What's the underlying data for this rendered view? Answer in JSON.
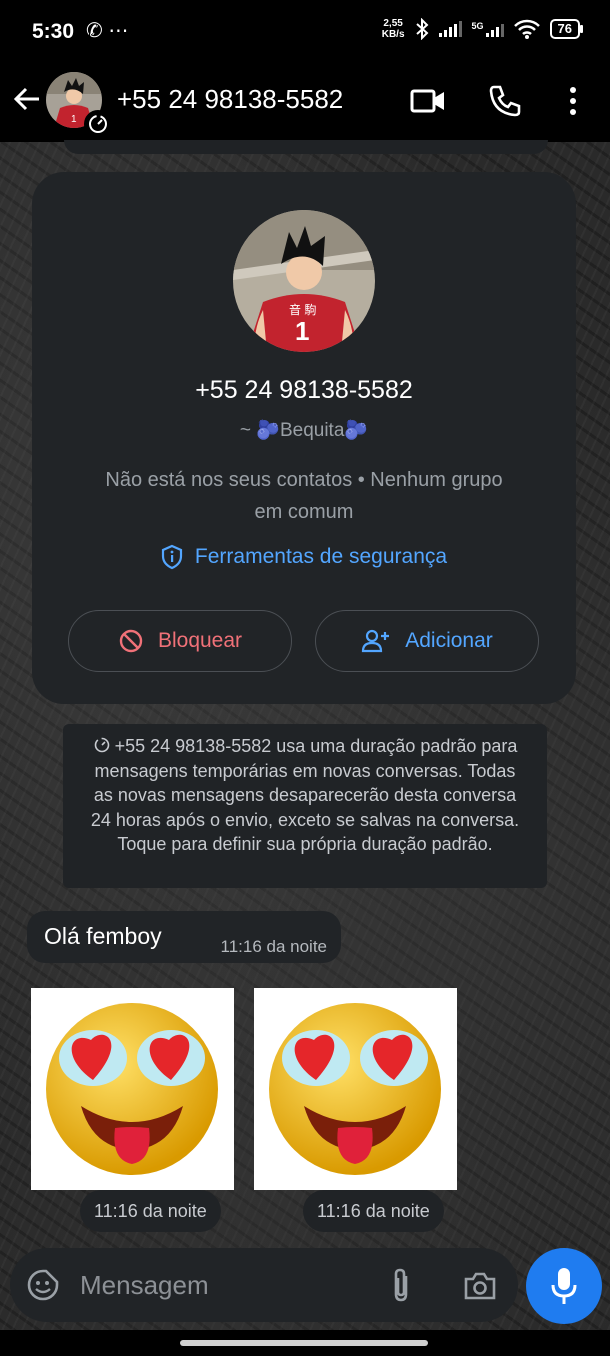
{
  "status_bar": {
    "time": "5:30",
    "left_icons": "✆ ⋯",
    "net_speed_value": "2,55",
    "net_speed_unit": "KB/s",
    "network": "5G",
    "battery": "76"
  },
  "header": {
    "title": "+55 24 98138-5582"
  },
  "profile_card": {
    "phone": "+55 24 98138-5582",
    "name": "~ 🫐Bequita🫐",
    "info_line1": "Não está nos seus contatos • Nenhum grupo",
    "info_line2": "em comum",
    "security_label": "Ferramentas de segurança",
    "block_label": "Bloquear",
    "add_label": "Adicionar"
  },
  "notice": {
    "text": "+55 24 98138-5582 usa uma duração padrão para mensagens temporárias em novas conversas. Todas as novas mensagens desaparecerão desta conversa 24 horas após o envio, exceto se salvas na conversa. Toque para definir sua própria duração padrão."
  },
  "messages": [
    {
      "text": "Olá femboy",
      "time": "11:16 da noite"
    }
  ],
  "stickers": [
    {
      "icon": "heart-eyes-emoji-sticker",
      "time": "11:16 da noite"
    },
    {
      "icon": "heart-eyes-emoji-sticker",
      "time": "11:16 da noite"
    }
  ],
  "input": {
    "placeholder": "Mensagem"
  },
  "colors": {
    "accent_blue": "#53a6ff",
    "block_red": "#f07178",
    "mic_button": "#1f7cf0",
    "card_bg": "#212427"
  }
}
